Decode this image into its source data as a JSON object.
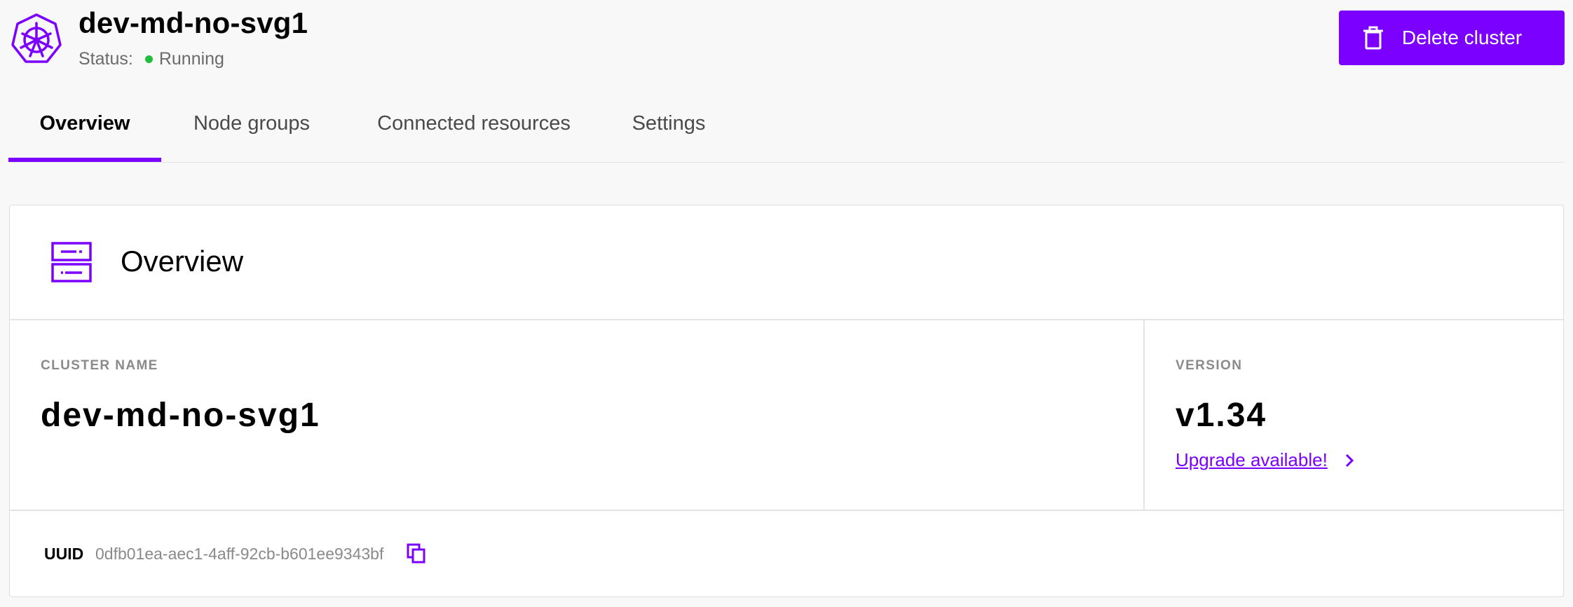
{
  "header": {
    "cluster_name": "dev-md-no-svg1",
    "status_label": "Status:",
    "status_value": "Running",
    "delete_button": "Delete cluster"
  },
  "tabs": [
    {
      "label": "Overview",
      "active": true
    },
    {
      "label": "Node groups",
      "active": false
    },
    {
      "label": "Connected resources",
      "active": false
    },
    {
      "label": "Settings",
      "active": false
    }
  ],
  "overview": {
    "title": "Overview",
    "cluster_name_label": "CLUSTER NAME",
    "cluster_name_value": "dev-md-no-svg1",
    "version_label": "VERSION",
    "version_value": "v1.34",
    "upgrade_link": "Upgrade available!",
    "uuid_label": "UUID",
    "uuid_value": "0dfb01ea-aec1-4aff-92cb-b601ee9343bf"
  },
  "icons": {
    "logo": "kubernetes-icon",
    "delete": "trash-icon",
    "section": "server-icon",
    "upgrade": "chevron-right-icon",
    "copy": "copy-icon"
  },
  "colors": {
    "accent": "#7b00ff",
    "status_running": "#1fbf3c"
  }
}
